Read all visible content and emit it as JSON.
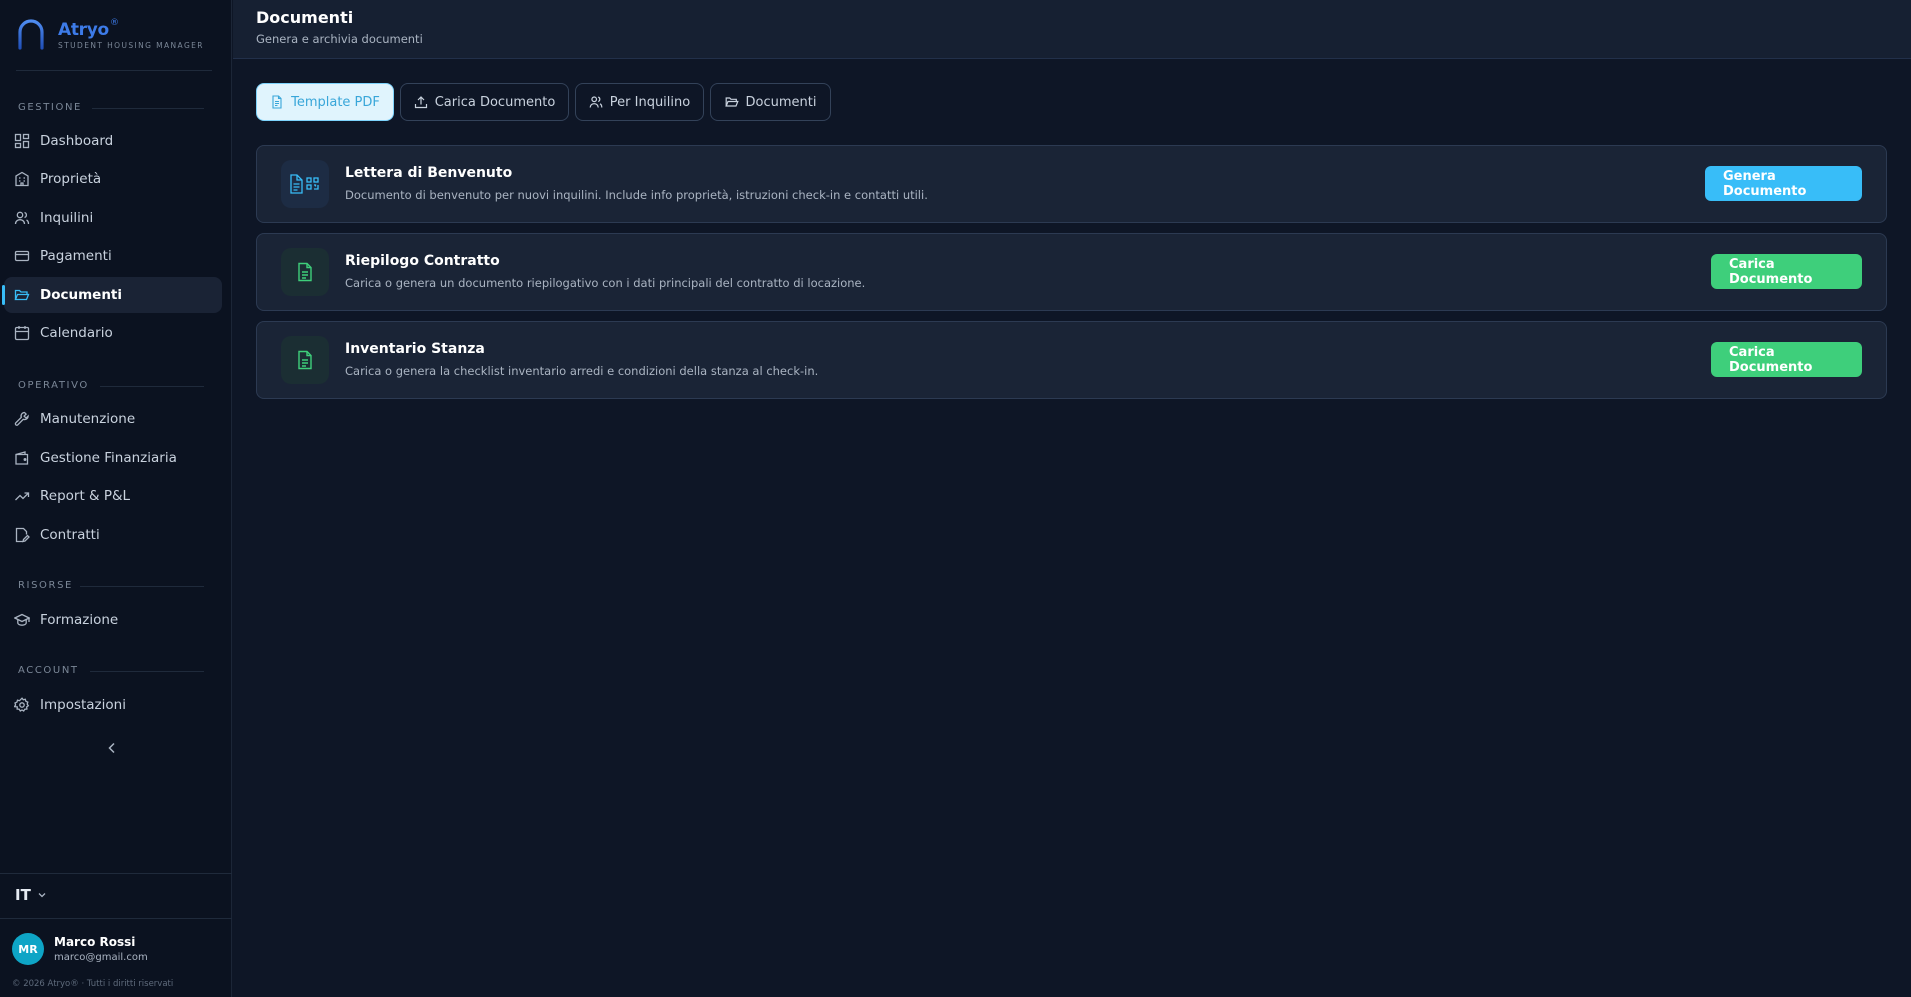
{
  "brand": {
    "name": "Atryo",
    "reg": "®",
    "tagline": "STUDENT HOUSING MANAGER",
    "color": "#3d7be8"
  },
  "sidebar": {
    "sections": [
      {
        "label": "GESTIONE"
      },
      {
        "label": "OPERATIVO"
      },
      {
        "label": "RISORSE"
      },
      {
        "label": "ACCOUNT"
      }
    ],
    "items": [
      {
        "label": "Dashboard",
        "icon": "grid-icon"
      },
      {
        "label": "Proprietà",
        "icon": "building-icon"
      },
      {
        "label": "Inquilini",
        "icon": "users-icon"
      },
      {
        "label": "Pagamenti",
        "icon": "credit-card-icon"
      },
      {
        "label": "Documenti",
        "icon": "folder-open-icon",
        "active": true
      },
      {
        "label": "Calendario",
        "icon": "calendar-icon"
      },
      {
        "label": "Manutenzione",
        "icon": "wrench-icon"
      },
      {
        "label": "Gestione Finanziaria",
        "icon": "wallet-icon"
      },
      {
        "label": "Report & P&L",
        "icon": "trending-up-icon"
      },
      {
        "label": "Contratti",
        "icon": "file-edit-icon"
      },
      {
        "label": "Formazione",
        "icon": "graduation-cap-icon"
      },
      {
        "label": "Impostazioni",
        "icon": "gear-icon"
      }
    ],
    "language": "IT",
    "user": {
      "initials": "MR",
      "name": "Marco Rossi",
      "email": "marco@gmail.com"
    },
    "copyright": "© 2026 Atryo® · Tutti i diritti riservati"
  },
  "header": {
    "title": "Documenti",
    "subtitle": "Genera e archivia documenti"
  },
  "tabs": [
    {
      "label": "Template PDF",
      "icon": "file-text-icon",
      "active": true
    },
    {
      "label": "Carica Documento",
      "icon": "upload-icon"
    },
    {
      "label": "Per Inquilino",
      "icon": "users-icon"
    },
    {
      "label": "Documenti",
      "icon": "folder-open-icon"
    }
  ],
  "templates": [
    {
      "title": "Lettera di Benvenuto",
      "description": "Documento di benvenuto per nuovi inquilini. Include info proprietà, istruzioni check-in e contatti utili.",
      "button": "Genera Documento",
      "accent": "#38bdf8",
      "icon": "file-qr-icon"
    },
    {
      "title": "Riepilogo Contratto",
      "description": "Carica o genera un documento riepilogativo con i dati principali del contratto di locazione.",
      "button": "Carica Documento",
      "accent": "#3ecf7b",
      "icon": "file-text-icon"
    },
    {
      "title": "Inventario Stanza",
      "description": "Carica o genera la checklist inventario arredi e condizioni della stanza al check-in.",
      "button": "Carica Documento",
      "accent": "#3ecf7b",
      "icon": "file-text-icon"
    }
  ]
}
